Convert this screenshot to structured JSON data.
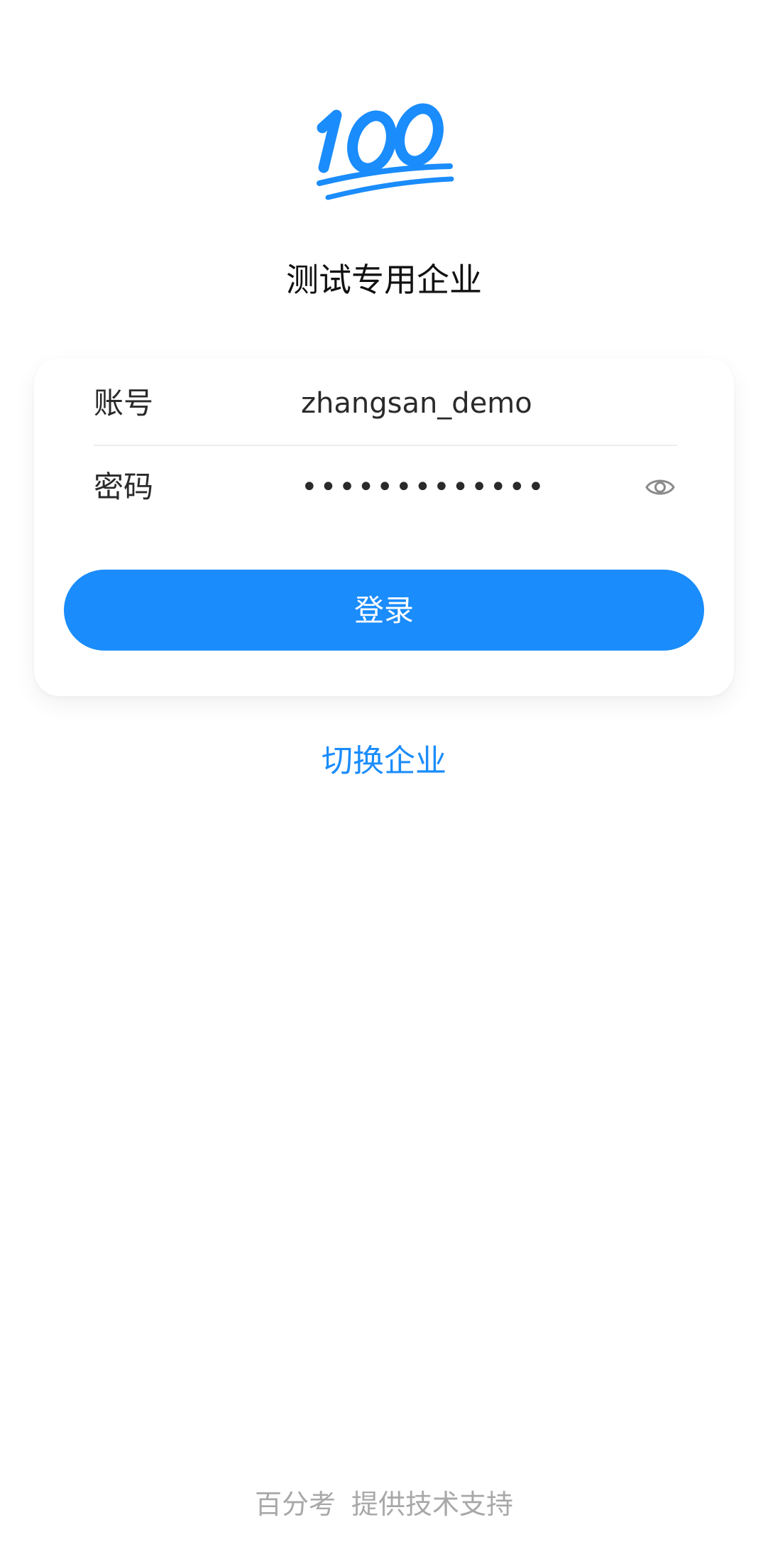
{
  "logo": {
    "icon": "hundred-points-icon",
    "text": "100",
    "color": "#1a8cfb"
  },
  "org_name": "测试专用企业",
  "form": {
    "account_label": "账号",
    "account_value": "zhangsan_demo",
    "password_label": "密码",
    "password_value": "•••••••••••••",
    "password_toggle_icon": "eye-icon",
    "login_label": "登录"
  },
  "switch_link": "切换企业",
  "footer": "百分考  提供技术支持",
  "colors": {
    "accent": "#1a8cfb",
    "footer_text": "#a8a8a8"
  }
}
